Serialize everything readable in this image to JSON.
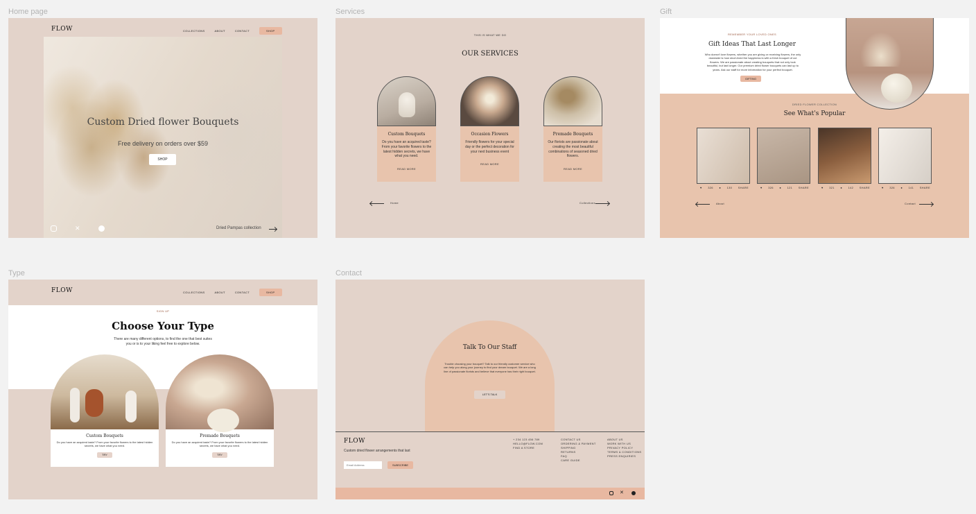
{
  "frames": {
    "home": {
      "label": "Home page",
      "logo": "FLOW",
      "nav": [
        "COLLECTIONS",
        "ABOUT",
        "CONTACT"
      ],
      "shop": "SHOP",
      "hero_title": "Custom Dried flower Bouquets",
      "hero_sub": "Free delivery on orders over $59",
      "hero_button": "SHOP",
      "collection_link": "Dried Pampas collection",
      "social": [
        "instagram-icon",
        "x-icon",
        "facebook-icon"
      ]
    },
    "services": {
      "label": "Services",
      "eyebrow": "THIS IS WHAT WE DO",
      "title": "OUR SERVICES",
      "cards": [
        {
          "title": "Custom Bouquets",
          "text": "Do you have an acquired taste? From your favorite flowers to the latest hidden secrets, we have what you need.",
          "link": "READ MORE"
        },
        {
          "title": "Occasion Flowers",
          "text": "Friendly flowers for your special day or the perfect decoration for your next business event",
          "link": "READ MORE"
        },
        {
          "title": "Premade Bouquets",
          "text": "Our florists are passionate about creating the most beautiful combinations of seasoned dried flowers.",
          "link": "READ MORE"
        }
      ],
      "prev": "Home",
      "next": "Collections"
    },
    "gift": {
      "label": "Gift",
      "eyebrow": "REMEMBER YOUR LOVED ONES",
      "title": "Gift Ideas That Last Longer",
      "text": "Who doesn't love flowers, whether you are giving or receiving flowers, the only downside is how short-lived the happiness is with a fresh bouquet of cut flowers. We are passionate about creating bouquets that not only look beautiful, but last longer. Our premium dried flower bouquets can last up to years. Ask our staff for more information for your perfect bouquet.",
      "button": "GIFTING",
      "section_eyebrow": "DRIED FLOWER COLLECTION",
      "section_title": "See What's Popular",
      "products": [
        {
          "likes": "326",
          "comments": "130",
          "share": "SHARE"
        },
        {
          "likes": "326",
          "comments": "121",
          "share": "SHARE"
        },
        {
          "likes": "321",
          "comments": "142",
          "share": "SHARE"
        },
        {
          "likes": "326",
          "comments": "141",
          "share": "SHARE"
        }
      ],
      "prev": "About",
      "next": "Contact"
    },
    "type": {
      "label": "Type",
      "logo": "FLOW",
      "nav": [
        "COLLECTIONS",
        "ABOUT",
        "CONTACT"
      ],
      "shop": "SHOP",
      "eyebrow": "SIGN UP",
      "title": "Choose Your Type",
      "sub": "There are many different options, to find the one that best suites you or is to your liking feel free to explore below.",
      "cards": [
        {
          "title": "Custom Bouquets",
          "text": "Do you have an acquired taste? From your favorite flowers to the latest hidden secrets, we have what you need.",
          "button": "TRY"
        },
        {
          "title": "Premade Bouquets",
          "text": "Do you have an acquired taste? From your favorite flowers to the latest hidden secrets, we have what you need.",
          "button": "TRY"
        }
      ]
    },
    "contact": {
      "label": "Contact",
      "title": "Talk To Our Staff",
      "text": "Trouble choosing your bouquet? Talk to our friendly customer service who can help you along your journey to find your dream bouquet. We are a long line of passionate florists and believe that everyone has their right bouquet.",
      "button": "LET'S TALK",
      "footer": {
        "logo": "FLOW",
        "tagline": "Custom dried flower arrangements that last",
        "email_placeholder": "Email Address",
        "subscribe": "SUBSCRIBE",
        "col1": [
          "+ 234 123 456 789",
          "HELLO@FLOW.COM",
          "FIND A STORE"
        ],
        "col2": [
          "CONTACT US",
          "ORDERING & PAYMENT",
          "SHIPPING",
          "RETURNS",
          "FAQ",
          "CARE GUIDE"
        ],
        "col3": [
          "ABOUT US",
          "WORK WITH US",
          "PRIVACY POLICY",
          "TERMS & CONDITIONS",
          "PRESS ENQUIRIES"
        ]
      }
    }
  },
  "colors": {
    "frame_bg": "#e3d3ca",
    "salmon": "#e8c4ad",
    "pill": "#e8b8a1",
    "canvas": "#f2f2f2"
  }
}
